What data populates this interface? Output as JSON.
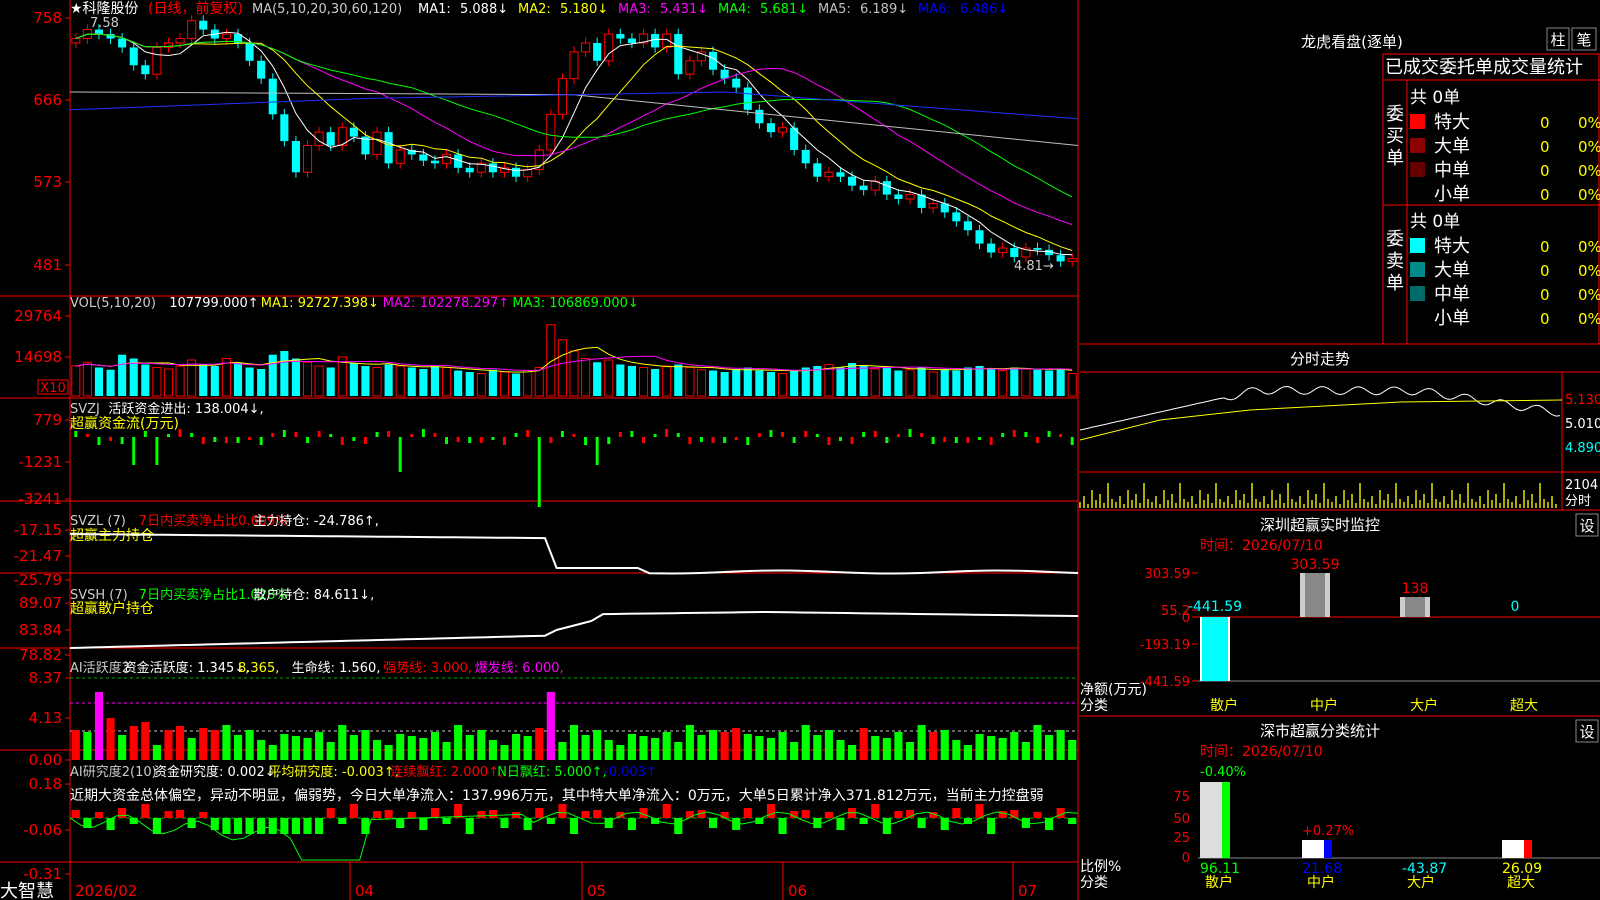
{
  "stock": {
    "title": "★科隆股份",
    "mode": "(日线，前复权)"
  },
  "ma": {
    "label": "MA(5,10,20,30,60,120)",
    "items": [
      [
        "MA1:",
        "5.088↓",
        "#ffffff"
      ],
      [
        "MA2:",
        "5.180↓",
        "#ffff00"
      ],
      [
        "MA3:",
        "5.431↓",
        "#ff00ff"
      ],
      [
        "MA4:",
        "5.681↓",
        "#00ff00"
      ],
      [
        "MA5:",
        "6.189↓",
        "#c0c0c0"
      ],
      [
        "MA6:",
        "6.486↓",
        "#0000ff"
      ]
    ]
  },
  "price": {
    "ticks": [
      "758",
      "666",
      "573",
      "481"
    ],
    "tickv": [
      7.58,
      6.66,
      5.73,
      4.81
    ],
    "hi": "7.58",
    "lo": "4.81"
  },
  "vol": {
    "head": [
      [
        "VOL(5,10,20)",
        "#ccc"
      ],
      [
        "107799.000↑",
        "#fff"
      ],
      [
        "MA1: 92727.398↓",
        "#ff0"
      ],
      [
        "MA2: 102278.297↑",
        "#f0f"
      ],
      [
        "MA3: 106869.000↓",
        "#0f0"
      ]
    ],
    "ticks": [
      "29764",
      "14698"
    ],
    "x10": "X10"
  },
  "svzj": {
    "head": [
      [
        "SVZJ",
        "#ccc"
      ],
      [
        "活跃资金进出: 138.004↓,",
        "#fff"
      ]
    ],
    "sub": "超赢资金流(万元)",
    "ticks": [
      "779",
      "-1231",
      "-3241"
    ]
  },
  "svzl": {
    "head": [
      [
        "SVZL (7)",
        "#ccc"
      ],
      [
        "7日内买卖净占比0.609%",
        "#f00"
      ],
      [
        "主力持仓: -24.786↑,",
        "#fff"
      ]
    ],
    "sub": "超赢主力持仓",
    "ticks": [
      "-17.15",
      "-21.47",
      "-25.79"
    ]
  },
  "svsh": {
    "head": [
      [
        "SVSH (7)",
        "#ccc"
      ],
      [
        "7日内买卖净占比1.028%",
        "#0f0"
      ],
      [
        "散户持仓: 84.611↓,",
        "#fff"
      ]
    ],
    "sub": "超赢散户持仓",
    "ticks": [
      "89.07",
      "83.84",
      "78.82"
    ]
  },
  "ai1": {
    "head": [
      [
        "AI活跃度2",
        "#ccc"
      ],
      [
        "资金活跃度: 1.345↓,",
        "#fff"
      ],
      [
        "8.365,",
        "#ff0"
      ],
      [
        "生命线: 1.560,",
        "#fff"
      ],
      [
        "强势线: 3.000,",
        "#f00"
      ],
      [
        "爆发线: 6.000,",
        "#f0f"
      ]
    ],
    "ticks": [
      "8.37",
      "4.13",
      "0.00"
    ]
  },
  "ai2": {
    "head": [
      [
        "AI研究度2(10)",
        "#ccc"
      ],
      [
        "资金研究度: 0.002↓,",
        "#fff"
      ],
      [
        "平均研究度: -0.003↑,",
        "#ff0"
      ],
      [
        "连续飘红: 2.000↑,",
        "#f00"
      ],
      [
        "N日飘红: 5.000↑,",
        "#0f0"
      ],
      [
        "-0.003↑",
        "#00f"
      ]
    ],
    "text": "近期大资金总体偏空，异动不明显，偏弱势，今日大单净流入：137.996万元，其中特大单净流入：0万元，大单5日累计净入371.812万元，当前主力控盘弱",
    "ticks": [
      "0.18",
      "-0.06",
      "-0.31"
    ]
  },
  "dates": [
    "2026/02",
    "04",
    "05",
    "06",
    "07"
  ],
  "brand": "大智慧",
  "lhb": {
    "title": "龙虎看盘(逐单)",
    "btn1": "柱",
    "btn2": "笔",
    "head": "已成交委托单成交量统计",
    "buy": "委买单",
    "sell": "委卖单",
    "total": "共 0单",
    "rows": [
      "特大",
      "大单",
      "中单",
      "小单"
    ],
    "zero": "0",
    "pct": "0%",
    "buyc": [
      "#ff0000",
      "#8b0000",
      "#660000"
    ],
    "sellc": [
      "#00ffff",
      "#008b8b",
      "#006b6b"
    ]
  },
  "fs": {
    "title": "分时走势",
    "ticks": [
      "5.130",
      "5.010",
      "4.890"
    ],
    "vt": "2104",
    "vt2": "分时"
  },
  "sz": {
    "title": "深圳超赢实时监控",
    "time": "时间：2026/07/10",
    "btn": "设",
    "ticks": [
      "303.59",
      "55.2",
      "0",
      "-193.19",
      "-441.59"
    ],
    "lbl": "净额(万元)",
    "lbl2": "分类",
    "cats": [
      "散户",
      "中户",
      "大户",
      "超大"
    ],
    "vals": [
      "-441.59",
      "303.59",
      "138",
      "0"
    ],
    "nums": [
      -441.59,
      303.59,
      138,
      0
    ]
  },
  "sc": {
    "title": "深市超赢分类统计",
    "time": "时间：2026/07/10",
    "btn": "设",
    "ticks": [
      "75",
      "50",
      "25",
      "0"
    ],
    "lbl": "比例%",
    "lbl2": "分类",
    "cats": [
      "散户",
      "中户",
      "大户",
      "超大"
    ],
    "top": [
      "-0.40%",
      "+0.27%"
    ],
    "bot": [
      "96.11",
      "21.68",
      "-43.87",
      "26.09"
    ],
    "botc": [
      "#0f0",
      "#00f",
      "#0ff",
      "#ff0"
    ]
  },
  "chart_data": {
    "type": "candlestick",
    "x_range": [
      "2026/02",
      "2026/07"
    ],
    "ylim": [
      4.81,
      7.58
    ],
    "close": [
      7.35,
      7.45,
      7.4,
      7.35,
      7.25,
      7.05,
      6.95,
      7.25,
      7.3,
      7.35,
      7.55,
      7.45,
      7.35,
      7.4,
      7.3,
      7.1,
      6.9,
      6.5,
      6.2,
      5.85,
      6.15,
      6.3,
      6.15,
      6.35,
      6.25,
      6.05,
      6.3,
      5.95,
      6.1,
      6.05,
      5.98,
      5.95,
      6.05,
      5.9,
      5.85,
      5.95,
      5.85,
      5.9,
      5.8,
      5.88,
      6.1,
      6.5,
      6.9,
      7.2,
      7.3,
      7.1,
      7.4,
      7.35,
      7.3,
      7.4,
      7.25,
      7.4,
      6.95,
      7.1,
      7.2,
      7.0,
      6.9,
      6.8,
      6.55,
      6.4,
      6.3,
      6.35,
      6.1,
      5.95,
      5.8,
      5.85,
      5.8,
      5.7,
      5.65,
      5.75,
      5.6,
      5.55,
      5.6,
      5.45,
      5.5,
      5.4,
      5.3,
      5.2,
      5.05,
      4.95,
      5.0,
      4.9,
      5.0,
      4.98,
      4.92,
      4.85,
      4.88
    ],
    "volume": [
      40,
      45,
      38,
      35,
      55,
      50,
      42,
      38,
      36,
      40,
      48,
      42,
      40,
      50,
      44,
      38,
      36,
      55,
      60,
      50,
      45,
      40,
      38,
      52,
      44,
      40,
      38,
      42,
      40,
      38,
      36,
      40,
      38,
      34,
      32,
      30,
      35,
      32,
      30,
      34,
      38,
      95,
      75,
      60,
      50,
      45,
      48,
      42,
      40,
      38,
      36,
      40,
      42,
      38,
      35,
      34,
      32,
      36,
      38,
      34,
      32,
      30,
      34,
      38,
      40,
      42,
      38,
      44,
      40,
      36,
      38,
      34,
      35,
      38,
      32,
      36,
      34,
      38,
      40,
      36,
      34,
      38,
      36,
      35,
      34,
      36,
      30
    ]
  }
}
